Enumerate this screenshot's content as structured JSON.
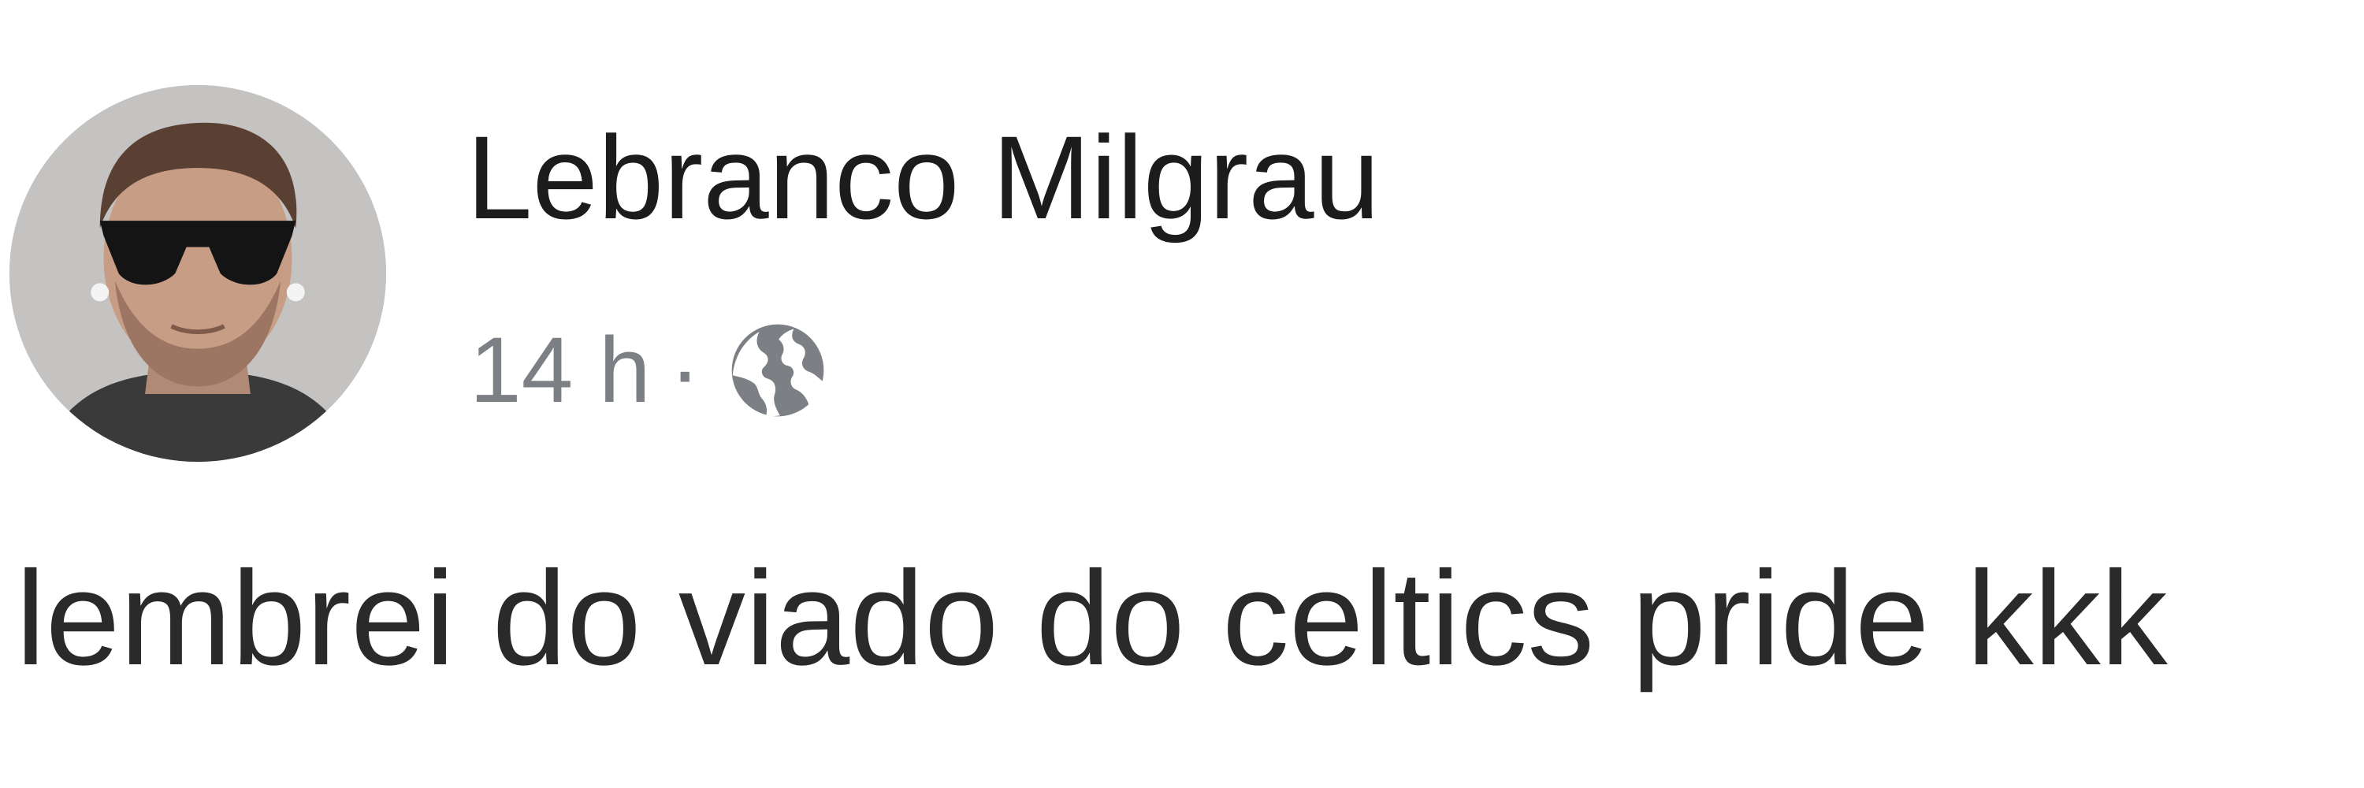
{
  "post": {
    "author": {
      "name": "Lebranco Milgrau",
      "avatar_icon": "profile-photo-man-sunglasses"
    },
    "meta": {
      "timestamp": "14 h",
      "separator": "·",
      "audience_icon": "globe-icon"
    },
    "text": "lembrei do viado do celtics pride kkk"
  },
  "colors": {
    "author_name": "#1c1c1c",
    "meta_text": "#7c7f84",
    "post_text": "#2a2a2a"
  }
}
